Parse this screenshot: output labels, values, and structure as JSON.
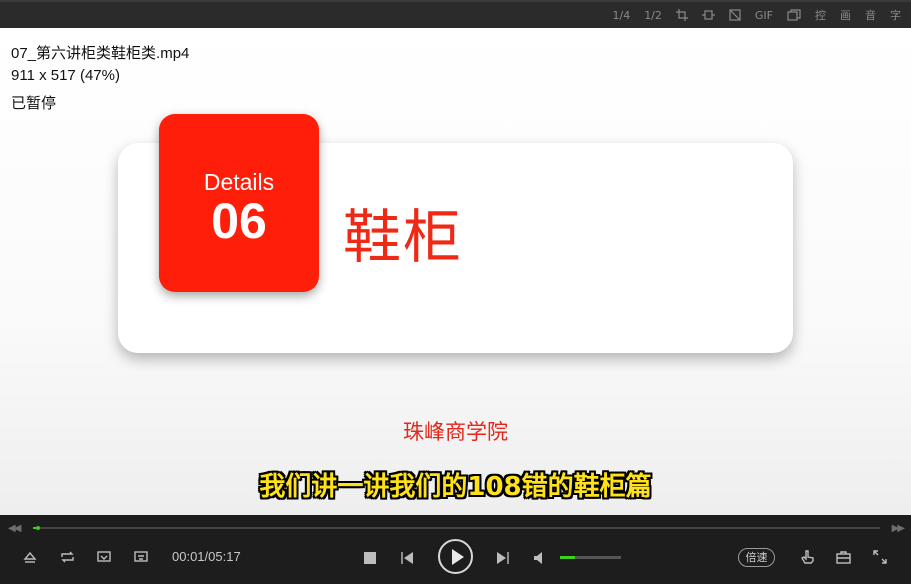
{
  "toolbar": {
    "ratio_quarter": "1/4",
    "ratio_half": "1/2",
    "gif_label": "GIF",
    "ctrl_label": "控",
    "pic_label": "画",
    "audio_label": "音",
    "subtitle_label": "字"
  },
  "osd": {
    "filename": "07_第六讲柜类鞋柜类.mp4",
    "resolution": "911 x 517 (47%)",
    "status": "已暂停"
  },
  "slide": {
    "details_label": "Details",
    "number": "06",
    "heading": "鞋柜",
    "brand": "珠峰商学院",
    "subtitle": "我们讲一讲我们的108错的鞋柜篇"
  },
  "player": {
    "current_time": "00:01",
    "separator": "/",
    "total_time": "05:17",
    "progress": 0.003,
    "volume": 0.25,
    "speed_label": "倍速"
  },
  "colors": {
    "accent": "#3cd11e",
    "slide_red": "#ff1e0a",
    "subtitle_yellow": "#ffe11a"
  }
}
